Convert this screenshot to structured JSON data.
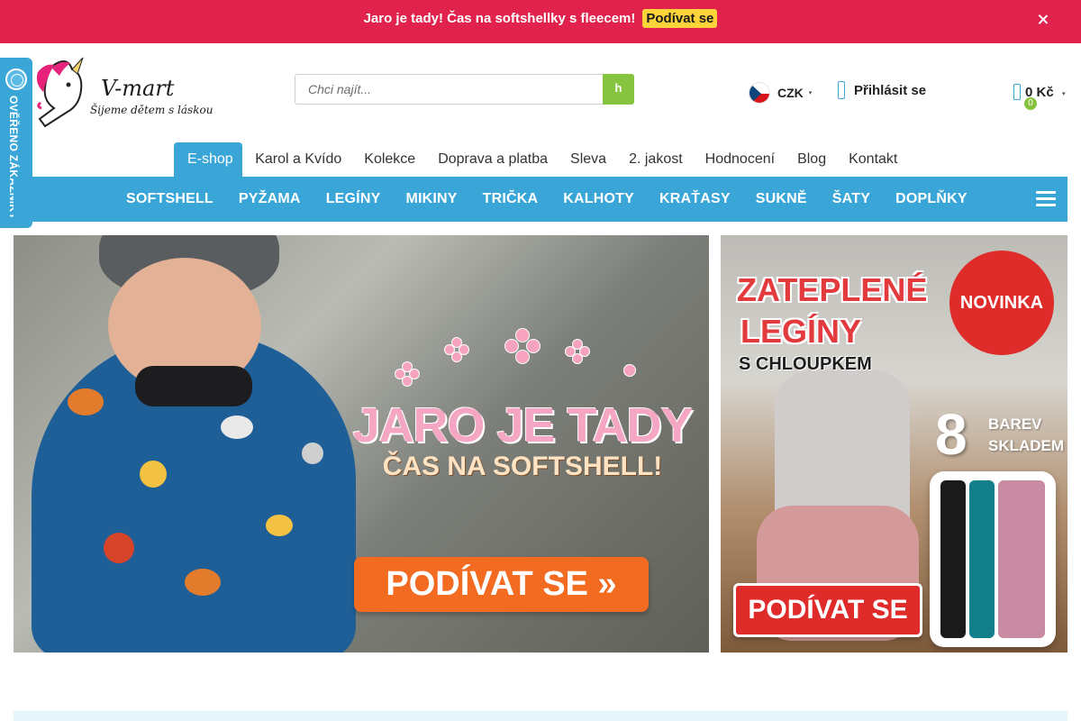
{
  "promo": {
    "icon_left": "",
    "text": "Jaro je tady! Čas na softshellky s fleecem!",
    "button": "Podívat se",
    "icon_right": ""
  },
  "verified": {
    "label": "OVĚŘENO ZÁKAZNÍKY"
  },
  "logo": {
    "name": "V-mart",
    "tagline": "Šijeme dětem s láskou"
  },
  "search": {
    "placeholder": "Chci najít...",
    "button_glyph": "h"
  },
  "currency": {
    "label": "CZK"
  },
  "account": {
    "login_label": "Přihlásit se"
  },
  "cart": {
    "total": "0 Kč",
    "count": "0"
  },
  "topnav": {
    "items": [
      "E-shop",
      "Karol a Kvído",
      "Kolekce",
      "Doprava a platba",
      "Sleva",
      "2. jakost",
      "Hodnocení",
      "Blog",
      "Kontakt"
    ]
  },
  "categories": {
    "items": [
      "SOFTSHELL",
      "PYŽAMA",
      "LEGÍNY",
      "MIKINY",
      "TRIČKA",
      "KALHOTY",
      "KRAŤASY",
      "SUKNĚ",
      "ŠATY",
      "DOPLŇKY"
    ]
  },
  "banner_main": {
    "title": "JARO JE TADY",
    "subtitle": "ČAS NA SOFTSHELL!",
    "cta": "PODÍVAT SE »"
  },
  "banner_side": {
    "title_line1": "ZATEPLENÉ",
    "title_line2": "LEGÍNY",
    "title_line3": "S CHLOUPKEM",
    "badge": "NOVINKA",
    "count": "8",
    "count_line1": "BAREV",
    "count_line2": "SKLADEM",
    "cta": "PODÍVAT SE"
  },
  "colors": {
    "promo_bg": "#e0224c",
    "accent_blue": "#3aa6d8",
    "accent_green": "#86c440",
    "promo_button": "#ffd43b",
    "cta_orange": "#f26b21",
    "cta_red": "#e02b2b"
  },
  "icons": {
    "close": "close-icon",
    "search": "search-icon",
    "user": "user-icon",
    "cart": "cart-icon",
    "menu": "hamburger-menu-icon",
    "flag": "czech-flag-icon"
  }
}
